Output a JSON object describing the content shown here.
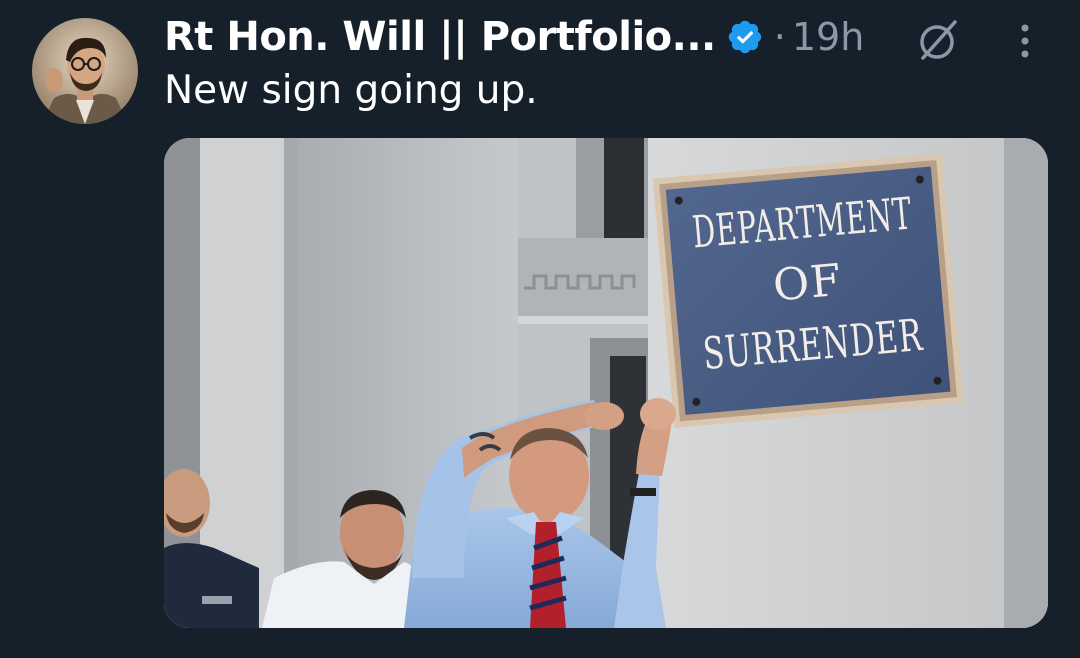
{
  "tweet": {
    "author_name": "Rt Hon. Will || Portfolio...",
    "separator": "·",
    "timestamp": "19h",
    "text": "New sign going up.",
    "icons": {
      "avatar": "profile-photo",
      "verified": "verified-badge-icon",
      "grok": "grok-icon",
      "more": "more-vertical-icon"
    },
    "colors": {
      "background": "#15202b",
      "verified": "#1d9bf0",
      "secondary_text": "#8b98a5",
      "sign_plaque": "#4a5f88"
    },
    "media": {
      "sign_lines": [
        "DEPARTMENT",
        "OF",
        "SURRENDER"
      ]
    }
  }
}
